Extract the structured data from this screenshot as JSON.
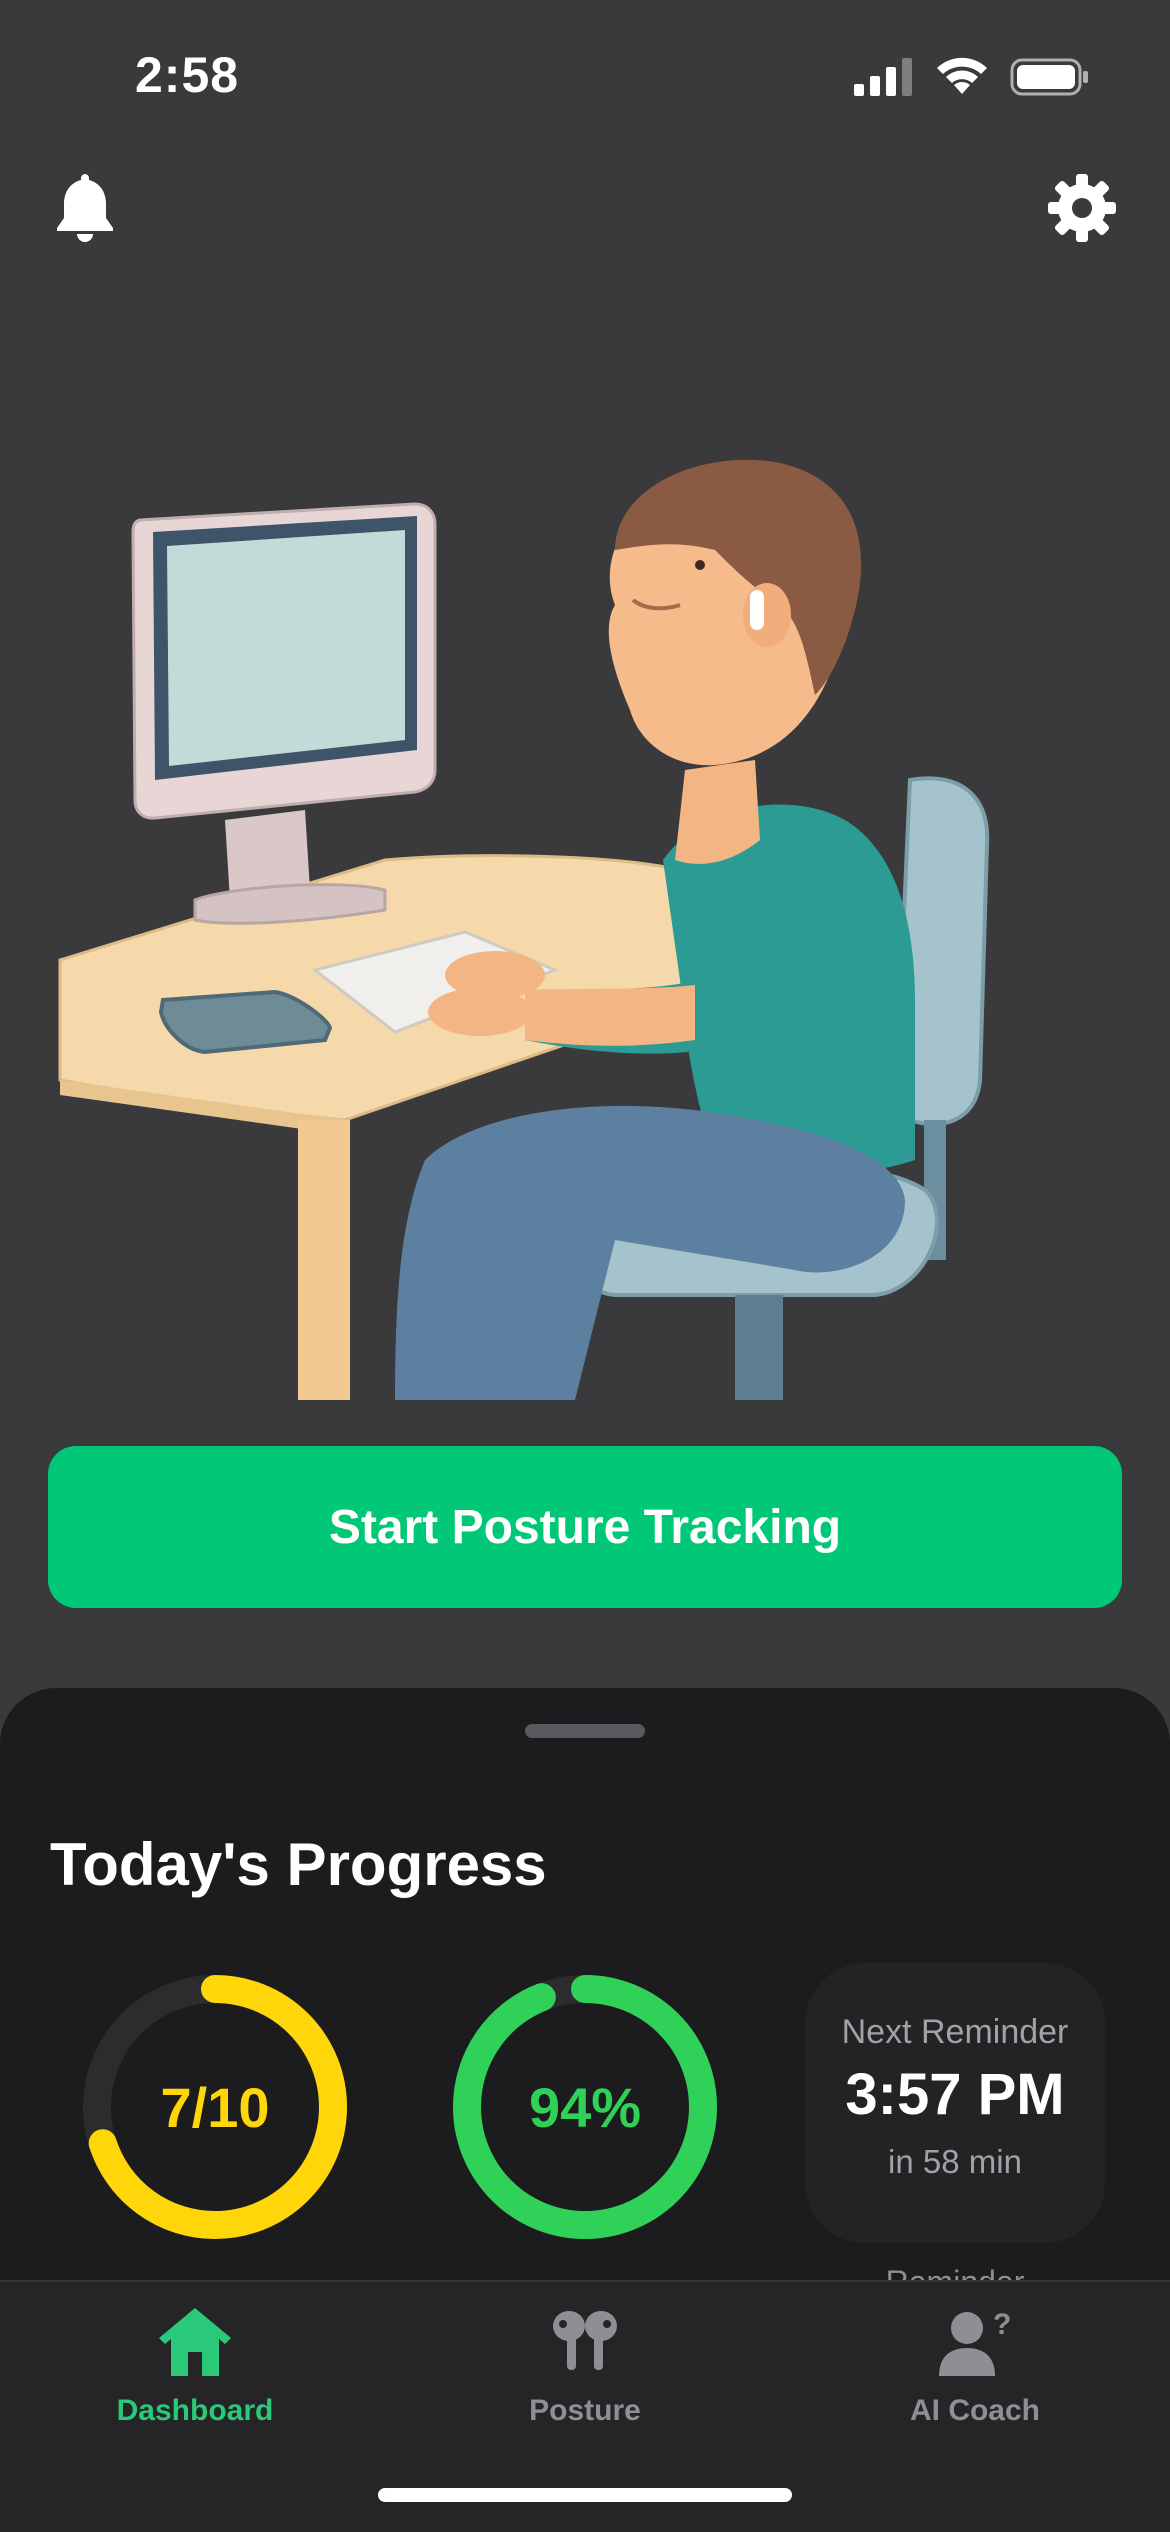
{
  "status_bar": {
    "time": "2:58"
  },
  "header": {
    "icons": [
      "bell-icon",
      "gear-icon"
    ]
  },
  "main": {
    "start_button_label": "Start Posture Tracking"
  },
  "progress": {
    "title": "Today's Progress",
    "posture_score": {
      "value": "7/10",
      "fraction": 0.7,
      "color": "#ffd60a"
    },
    "good_posture": {
      "value": "94%",
      "fraction": 0.94,
      "color": "#30d158"
    },
    "next_reminder": {
      "label": "Next Reminder",
      "time": "3:57 PM",
      "countdown": "in 58 min",
      "next_row_peek": "Reminder"
    }
  },
  "tab_bar": {
    "items": [
      {
        "label": "Dashboard",
        "icon": "home-icon",
        "active": true
      },
      {
        "label": "Posture",
        "icon": "airpods-icon",
        "active": false
      },
      {
        "label": "AI Coach",
        "icon": "person-question-icon",
        "active": false
      }
    ]
  },
  "colors": {
    "accent": "#00c876",
    "active_tab": "#2ac97a",
    "inactive_tab": "#8e8e93",
    "background": "#3a3a3c",
    "sheet": "#1c1c1e"
  }
}
